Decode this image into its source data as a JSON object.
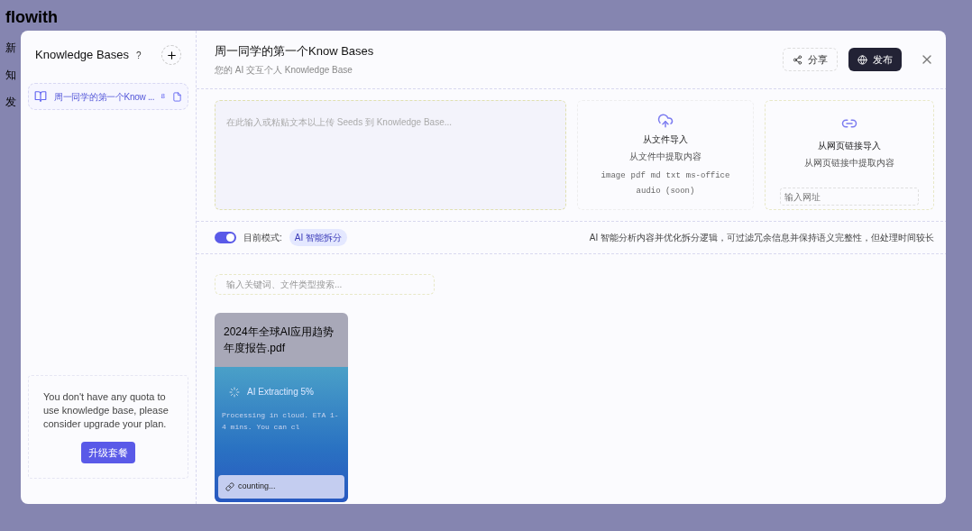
{
  "background_app": {
    "logo": "flowith",
    "nav_items": [
      "新",
      "知",
      "发"
    ]
  },
  "sidebar": {
    "title": "Knowledge Bases",
    "help": "?",
    "items": [
      {
        "label": "周一同学的第一个Know ...",
        "count": "8",
        "selected": true
      }
    ],
    "quota_notice": "You don't have any quota to use knowledge base, please consider upgrade your plan.",
    "upgrade_button": "升级套餐"
  },
  "header": {
    "title": "周一同学的第一个Know Bases",
    "subtitle": "您的 AI 交互个人 Knowledge Base",
    "share_button": "分享",
    "publish_button": "发布"
  },
  "text_input": {
    "placeholder": "在此输入或粘贴文本以上传 Seeds 到 Knowledge Base..."
  },
  "file_import": {
    "title": "从文件导入",
    "subtitle": "从文件中提取内容",
    "formats": [
      "image",
      "pdf",
      "md",
      "txt",
      "ms-office"
    ],
    "note": "audio (soon)"
  },
  "link_import": {
    "title": "从网页链接导入",
    "subtitle": "从网页链接中提取内容",
    "placeholder": "输入网址"
  },
  "mode": {
    "on": true,
    "label": "目前模式:",
    "value": "AI 智能拆分",
    "description": "AI 智能分析内容并优化拆分逻辑，可过滤冗余信息并保持语义完整性，但处理时间较长"
  },
  "search": {
    "placeholder": "输入关键词、文件类型搜索..."
  },
  "files": [
    {
      "name": "2024年全球AI应用趋势年度报告.pdf",
      "status": "AI Extracting 5%",
      "detail": "Processing in cloud. ETA 1-4 mins. You can cl",
      "footer": "counting..."
    }
  ]
}
